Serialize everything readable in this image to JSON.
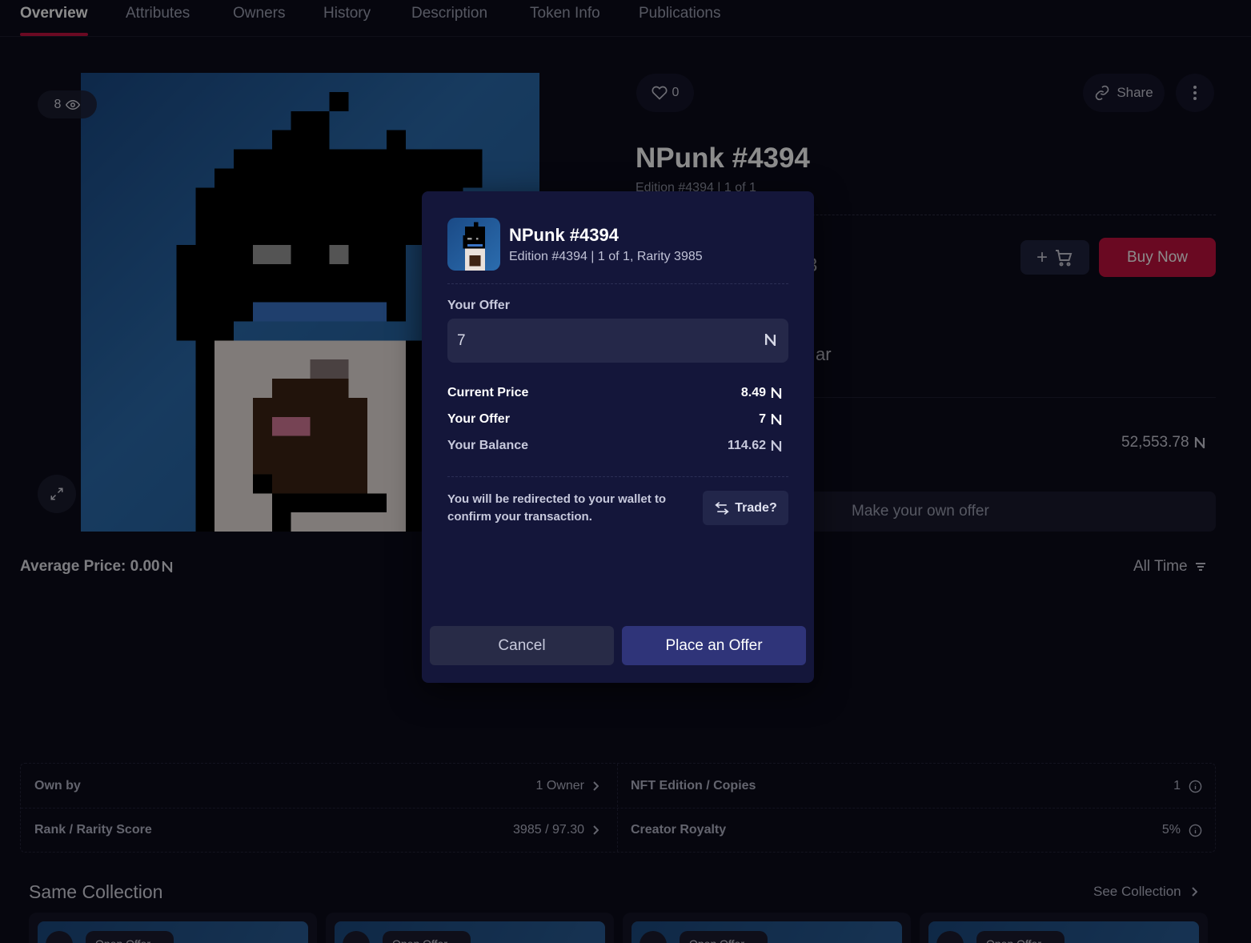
{
  "tabs": [
    {
      "label": "Overview",
      "active": true
    },
    {
      "label": "Attributes"
    },
    {
      "label": "Owners"
    },
    {
      "label": "History"
    },
    {
      "label": "Description"
    },
    {
      "label": "Token Info"
    },
    {
      "label": "Publications"
    }
  ],
  "artwork": {
    "views": "8"
  },
  "header": {
    "likes": "0",
    "share_label": "Share",
    "title": "NPunk #4394",
    "edition": "Edition #4394 | 1 of 1"
  },
  "purchase": {
    "buy_label": "Buy Now",
    "price_fragment": "3",
    "partial_text": "ar",
    "volume": "52,553.78",
    "offer_placeholder": "Make your own offer"
  },
  "price_history": {
    "average_label": "Average Price: 0.00",
    "range_label": "All Time"
  },
  "info": {
    "own_by_label": "Own by",
    "own_by_value": "1 Owner",
    "rank_label": "Rank / Rarity Score",
    "rank_value": "3985 / 97.30",
    "edition_label": "NFT Edition / Copies",
    "edition_value": "1",
    "royalty_label": "Creator Royalty",
    "royalty_value": "5%"
  },
  "same_collection": {
    "title": "Same Collection",
    "see_label": "See Collection",
    "cards": [
      {
        "tag": "Open Offer"
      },
      {
        "tag": "Open Offer"
      },
      {
        "tag": "Open Offer"
      },
      {
        "tag": "Open Offer"
      }
    ]
  },
  "modal": {
    "title": "NPunk #4394",
    "subtitle": "Edition #4394 | 1 of 1, Rarity 3985",
    "offer_label": "Your Offer",
    "offer_value": "7",
    "rows": [
      {
        "label": "Current Price",
        "value": "8.49"
      },
      {
        "label": "Your Offer",
        "value": "7"
      },
      {
        "label": "Your Balance",
        "value": "114.62"
      }
    ],
    "note": "You will be redirected to your wallet to confirm your transaction.",
    "trade_label": "Trade?",
    "cancel_label": "Cancel",
    "place_label": "Place an Offer"
  },
  "colors": {
    "background": "#0b0b1a",
    "accent": "#c2123e",
    "modal": "#14163a",
    "primary_button": "#2f3479"
  },
  "icons": {
    "near": "near-logo-icon",
    "eye": "eye-icon",
    "heart": "heart-icon",
    "share": "link-icon",
    "more": "kebab-icon",
    "cart": "cart-icon",
    "expand": "expand-icon",
    "info": "info-icon",
    "chevron": "chevron-right-icon",
    "filter": "filter-icon",
    "trade": "swap-icon"
  }
}
